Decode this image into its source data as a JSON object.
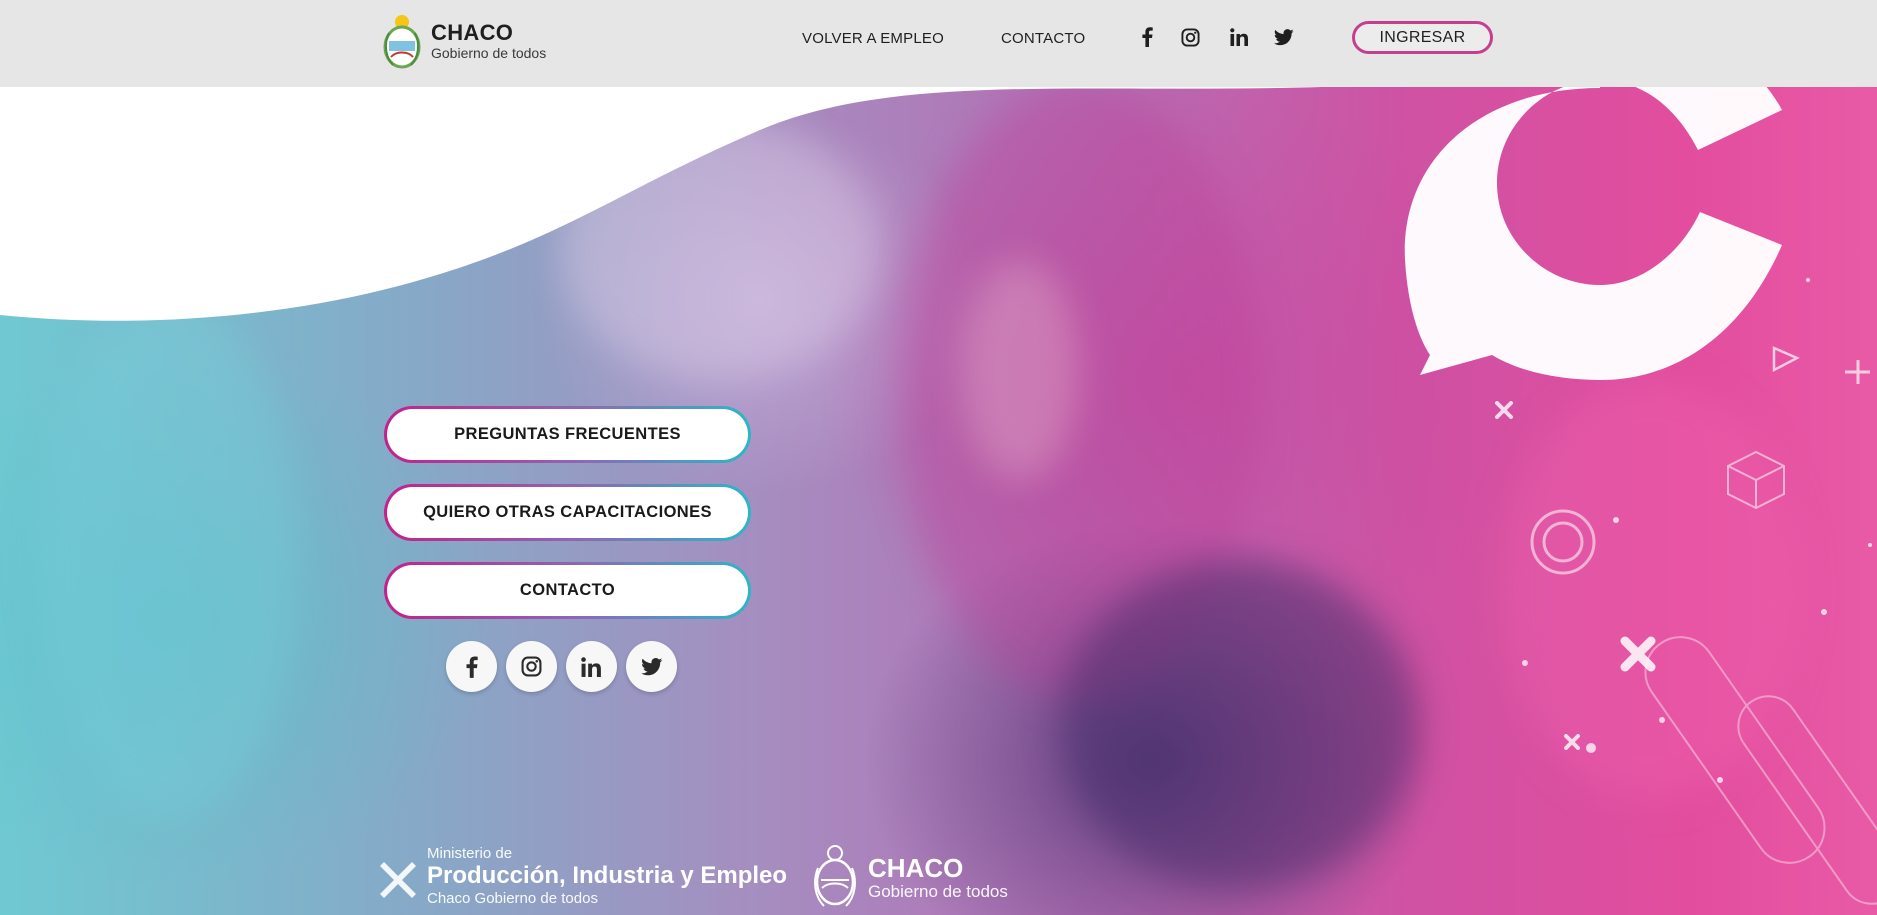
{
  "header": {
    "brand_title": "CHACO",
    "brand_subtitle": "Gobierno de todos",
    "nav": {
      "volver": "VOLVER A EMPLEO",
      "contacto": "CONTACTO"
    },
    "social_icons": [
      "facebook-icon",
      "instagram-icon",
      "linkedin-icon",
      "twitter-icon"
    ],
    "login_label": "INGRESAR"
  },
  "main": {
    "buttons": {
      "preguntas": "PREGUNTAS FRECUENTES",
      "capacitaciones": "QUIERO OTRAS CAPACITACIONES",
      "contacto": "CONTACTO"
    },
    "social_icons": [
      "facebook-icon",
      "instagram-icon",
      "linkedin-icon",
      "twitter-icon"
    ]
  },
  "footer": {
    "ministry_prefix": "Ministerio de",
    "ministry_name": "Producción, Industria y Empleo",
    "ministry_gov": "Chaco Gobierno de todos",
    "chaco_title": "CHACO",
    "chaco_subtitle": "Gobierno de todos"
  },
  "colors": {
    "accent_magenta": "#c4408f",
    "accent_cyan": "#2cb6c8",
    "header_bg": "#e6e6e6",
    "hero_pink": "#e34d9e",
    "hero_teal": "#6fc9d3"
  }
}
